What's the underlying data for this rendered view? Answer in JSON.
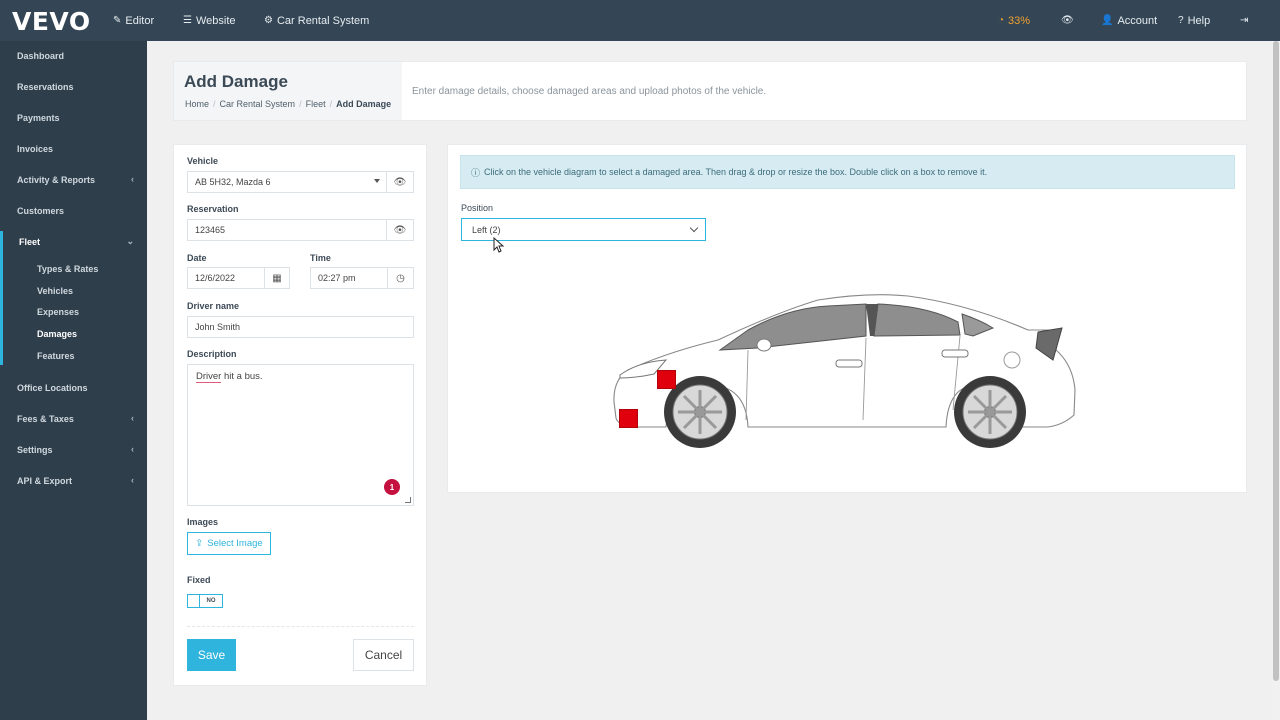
{
  "topbar": {
    "logo": "VEVO",
    "editor": "Editor",
    "website": "Website",
    "system": "Car Rental System",
    "progress": "33%",
    "account": "Account",
    "help": "Help"
  },
  "sidebar": {
    "dashboard": "Dashboard",
    "reservations": "Reservations",
    "payments": "Payments",
    "invoices": "Invoices",
    "activity": "Activity & Reports",
    "customers": "Customers",
    "fleet": "Fleet",
    "fleet_sub": {
      "types_rates": "Types & Rates",
      "vehicles": "Vehicles",
      "expenses": "Expenses",
      "damages": "Damages",
      "features": "Features"
    },
    "office": "Office Locations",
    "fees": "Fees & Taxes",
    "settings": "Settings",
    "api": "API & Export"
  },
  "header": {
    "title": "Add Damage",
    "crumb_home": "Home",
    "crumb_system": "Car Rental System",
    "crumb_fleet": "Fleet",
    "crumb_current": "Add Damage",
    "description": "Enter damage details, choose damaged areas and upload photos of the vehicle."
  },
  "form": {
    "vehicle_label": "Vehicle",
    "vehicle_value": "AB 5H32, Mazda 6",
    "reservation_label": "Reservation",
    "reservation_value": "123465",
    "date_label": "Date",
    "date_value": "12/6/2022",
    "time_label": "Time",
    "time_value": "02:27 pm",
    "driver_label": "Driver name",
    "driver_value": "John Smith",
    "description_label": "Description",
    "description_word1": "Driver",
    "description_rest": " hit a bus.",
    "description_badge": "1",
    "images_label": "Images",
    "select_image": "Select Image",
    "fixed_label": "Fixed",
    "fixed_toggle": "NO",
    "save": "Save",
    "cancel": "Cancel"
  },
  "diagram": {
    "info": "Click on the vehicle diagram to select a damaged area. Then drag & drop or resize the box. Double click on a box to remove it.",
    "position_label": "Position",
    "position_value": "Left (2)",
    "damage_color": "#e0000d"
  },
  "colors": {
    "accent": "#2fb4dd",
    "topbar": "#344655",
    "sidebar": "#2f3e4b",
    "badge": "#c4113f",
    "progress": "#f0a030"
  }
}
